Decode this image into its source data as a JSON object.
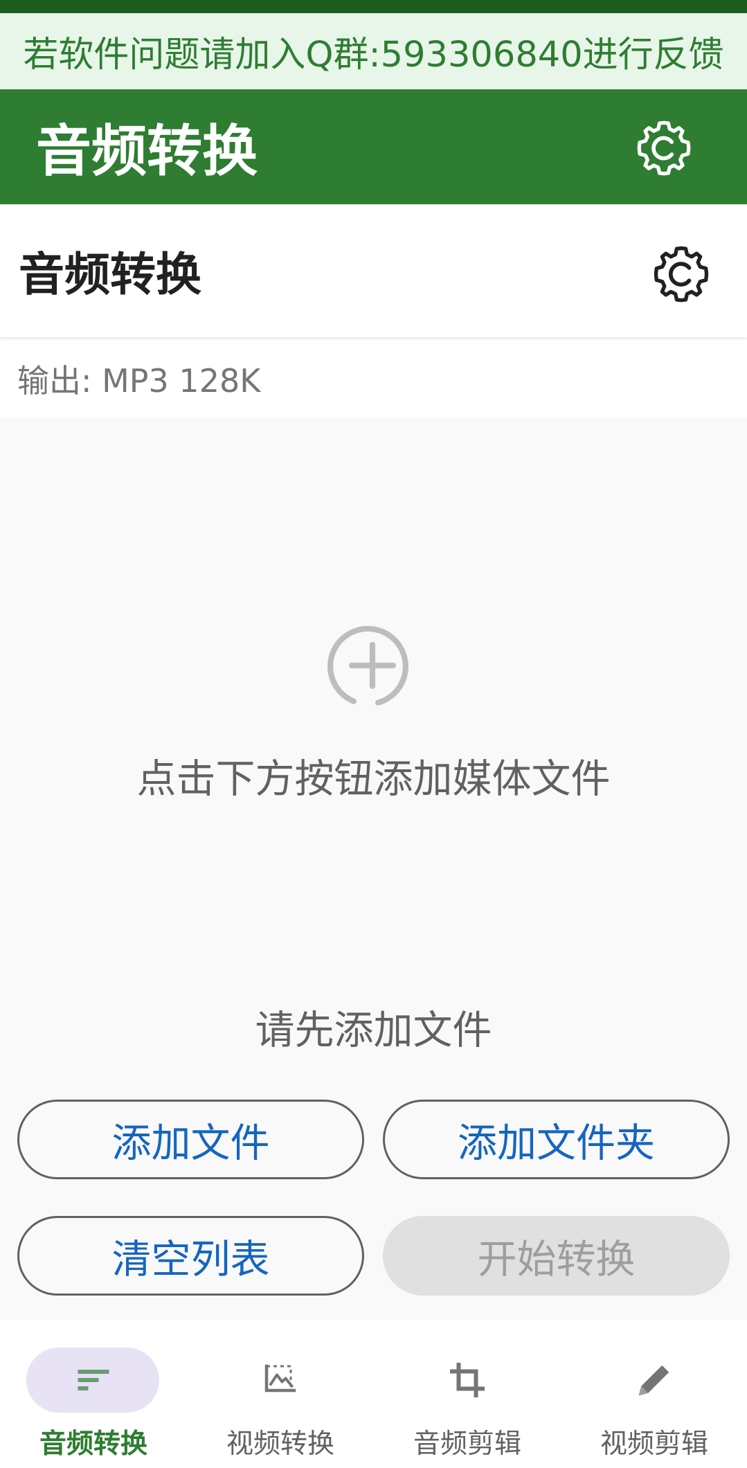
{
  "notice": {
    "text": "若软件问题请加入Q群:593306840进行反馈"
  },
  "app_bar": {
    "title": "音频转换",
    "settings_icon": "settings-gear-icon"
  },
  "sub_header": {
    "title": "音频转换",
    "settings_icon": "settings-gear-icon"
  },
  "output": {
    "label": "输出: MP3 128K"
  },
  "empty_state": {
    "icon": "add-circle-icon",
    "hint": "点击下方按钮添加媒体文件"
  },
  "status": {
    "message": "请先添加文件"
  },
  "actions": {
    "add_file": "添加文件",
    "add_folder": "添加文件夹",
    "clear_list": "清空列表",
    "start_convert": "开始转换",
    "start_convert_enabled": false
  },
  "bottom_nav": {
    "items": [
      {
        "label": "音频转换",
        "icon": "audio-sort-icon",
        "active": true
      },
      {
        "label": "视频转换",
        "icon": "image-frame-icon",
        "active": false
      },
      {
        "label": "音频剪辑",
        "icon": "crop-icon",
        "active": false
      },
      {
        "label": "视频剪辑",
        "icon": "pencil-icon",
        "active": false
      }
    ]
  },
  "colors": {
    "primary": "#2e7d32",
    "primary_dark": "#1b5e20",
    "notice_bg": "#e8f5e9",
    "button_text": "#1565c0",
    "nav_active_pill": "#e8e2f5"
  }
}
